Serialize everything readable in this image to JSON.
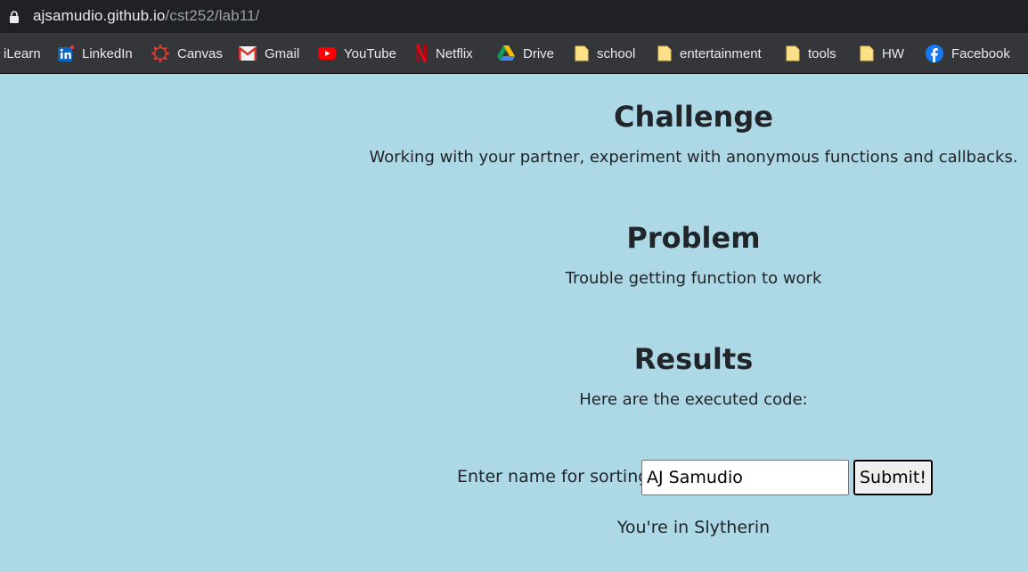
{
  "browser": {
    "url_host": "ajsamudio.github.io",
    "url_path": "/cst252/lab11/",
    "bookmarks": [
      {
        "label": "iLearn",
        "icon": "none"
      },
      {
        "label": "LinkedIn",
        "icon": "linkedin-icon"
      },
      {
        "label": "Canvas",
        "icon": "canvas-icon"
      },
      {
        "label": "Gmail",
        "icon": "gmail-icon"
      },
      {
        "label": "YouTube",
        "icon": "youtube-icon"
      },
      {
        "label": "Netflix",
        "icon": "netflix-icon"
      },
      {
        "label": "Drive",
        "icon": "drive-icon"
      },
      {
        "label": "school",
        "icon": "folder-icon"
      },
      {
        "label": "entertainment",
        "icon": "folder-icon"
      },
      {
        "label": "tools",
        "icon": "folder-icon"
      },
      {
        "label": "HW",
        "icon": "folder-icon"
      },
      {
        "label": "Facebook",
        "icon": "facebook-icon"
      }
    ]
  },
  "page": {
    "challenge_title": "Challenge",
    "challenge_text": "Working with your partner, experiment with anonymous functions and callbacks.",
    "problem_title": "Problem",
    "problem_text": "Trouble getting function to work",
    "results_title": "Results",
    "results_text": "Here are the executed code:",
    "form_label": "Enter name for sorting:",
    "name_value": "AJ Samudio",
    "submit_label": "Submit!",
    "result_text": "You're in Slytherin"
  },
  "colors": {
    "page_background": "#add8e6",
    "browser_chrome": "#35363a",
    "address_bar": "#202124",
    "text": "#212529"
  }
}
